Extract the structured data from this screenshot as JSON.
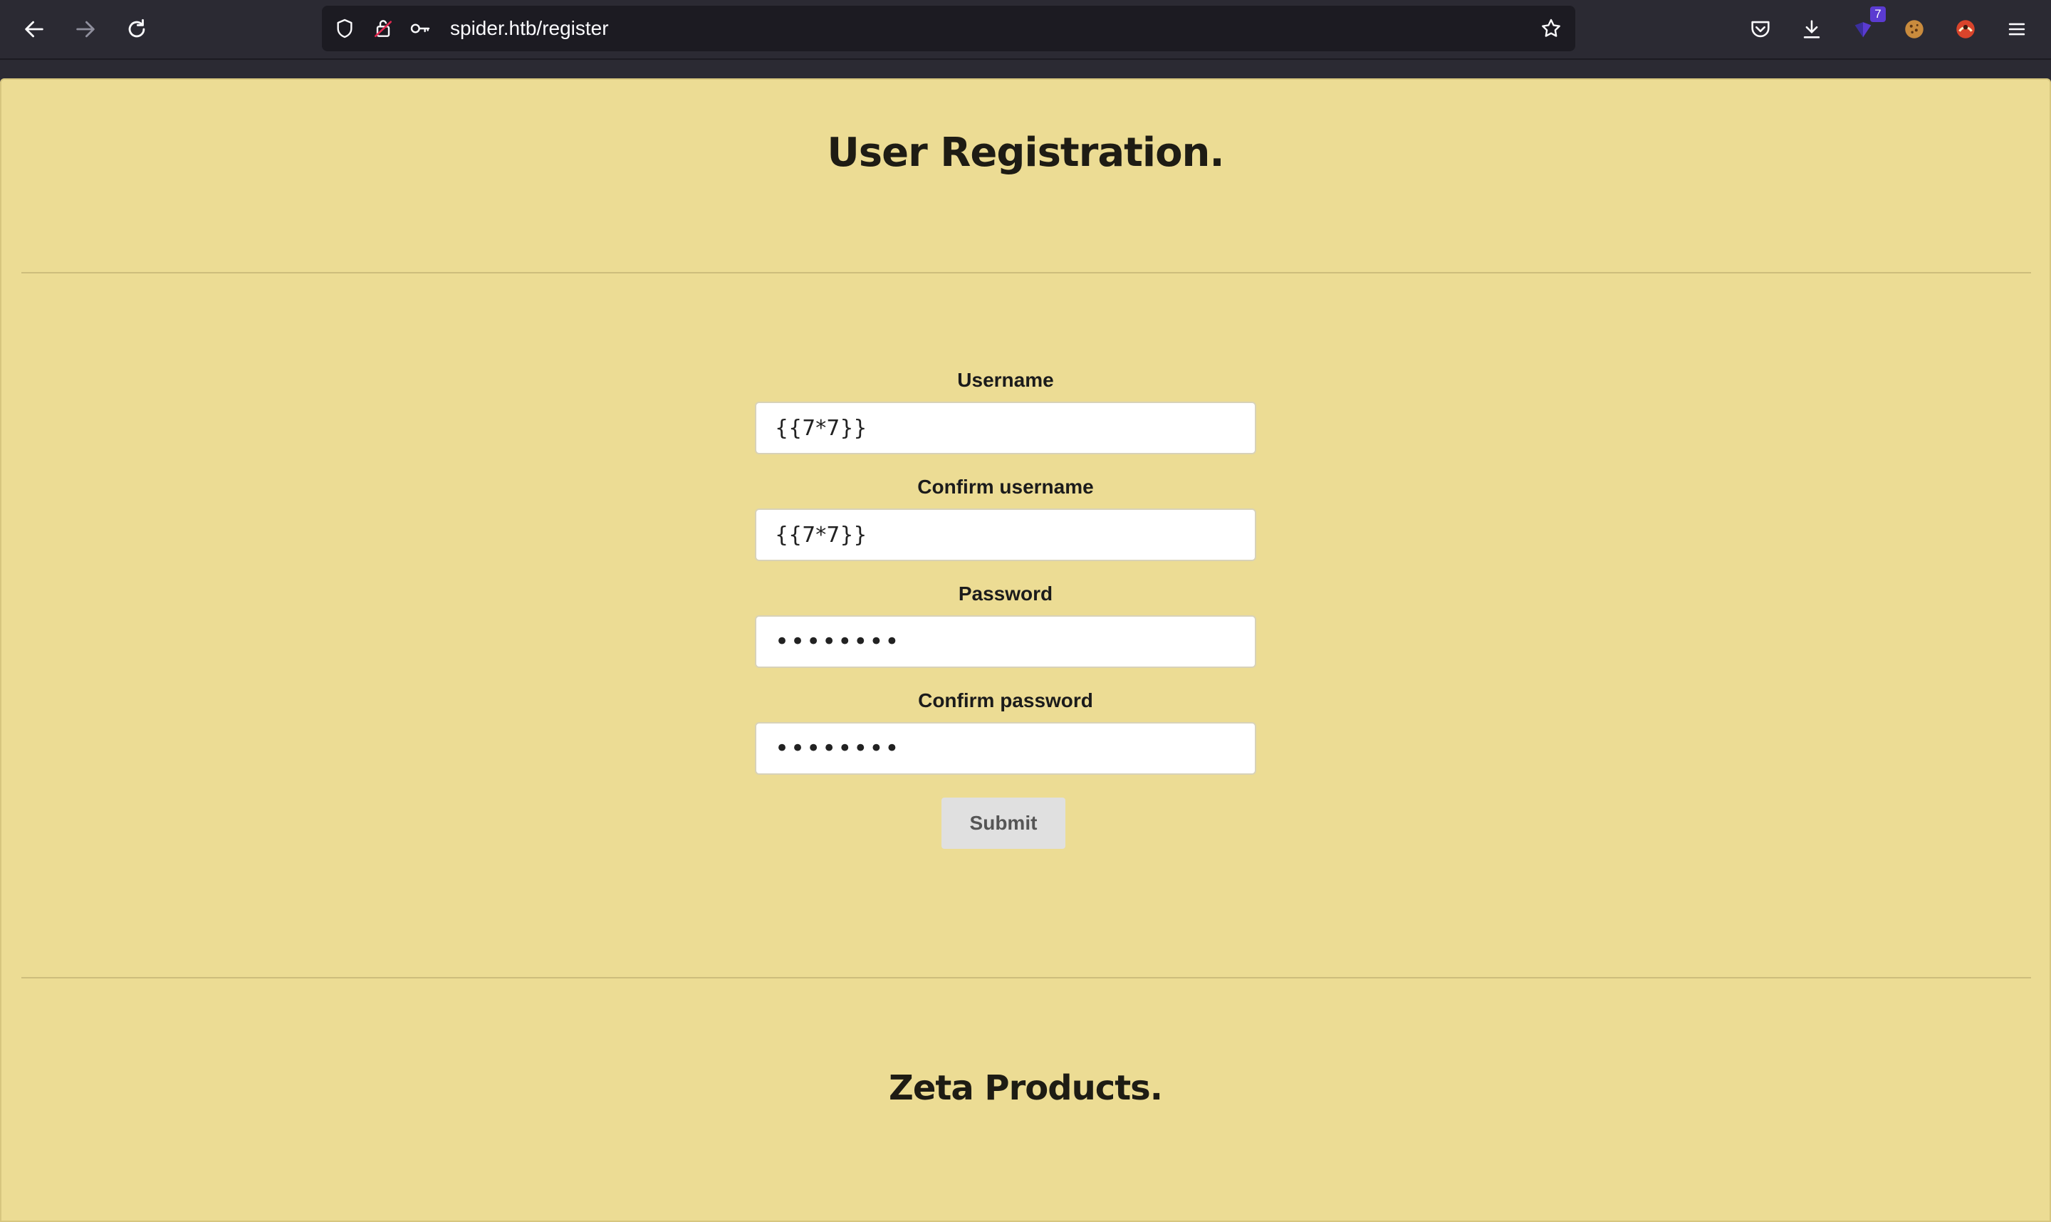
{
  "browser": {
    "url": "spider.htb/register",
    "extension_badge": "7"
  },
  "page": {
    "title": "User Registration.",
    "section_title": "Zeta Products."
  },
  "form": {
    "username_label": "Username",
    "username_value": "{{7*7}}",
    "confirm_username_label": "Confirm username",
    "confirm_username_value": "{{7*7}}",
    "password_label": "Password",
    "password_value": "••••••••",
    "confirm_password_label": "Confirm password",
    "confirm_password_value": "••••••••",
    "submit_label": "Submit"
  },
  "colors": {
    "page_background": "#ecdc94",
    "toolbar_background": "#2b2a33",
    "urlbar_background": "#1c1b22"
  }
}
